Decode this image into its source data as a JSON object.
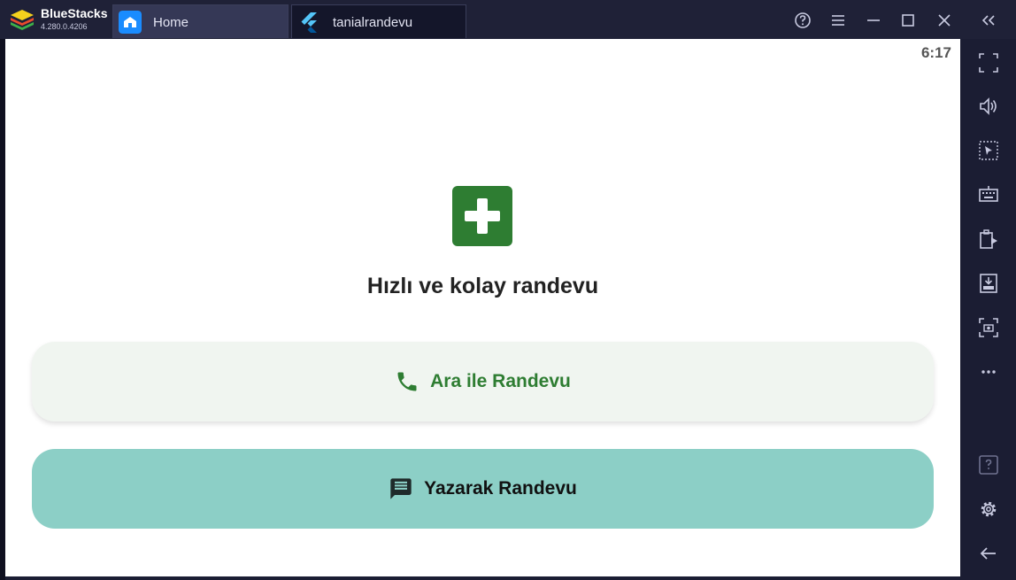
{
  "titlebar": {
    "brand_name": "BlueStacks",
    "brand_version": "4.280.0.4206",
    "tabs": [
      {
        "label": "Home",
        "icon": "home-icon"
      },
      {
        "label": "tanialrandevu",
        "icon": "flutter-icon"
      }
    ],
    "controls": [
      "help-icon",
      "menu-icon",
      "minimize-icon",
      "maximize-icon",
      "close-icon",
      "collapse-sidebar-icon"
    ]
  },
  "sidebar": {
    "top_items": [
      "fullscreen-icon",
      "volume-icon",
      "select-cursor-icon",
      "keyboard-icon",
      "copy-paste-icon",
      "apk-install-icon",
      "screenshot-icon",
      "more-icon"
    ],
    "bottom_items": [
      "help-icon",
      "settings-icon",
      "back-icon"
    ]
  },
  "android": {
    "clock": "6:17",
    "hero_icon": "medical-cross-icon",
    "headline": "Hızlı ve kolay randevu",
    "buttons": [
      {
        "label": "Ara ile Randevu",
        "icon": "phone-icon"
      },
      {
        "label": "Yazarak Randevu",
        "icon": "chat-icon"
      }
    ]
  },
  "colors": {
    "titlebar_bg": "#1f2137",
    "primary_green": "#2e7d32",
    "call_button_bg": "#f0f5f0",
    "write_button_bg": "#8ccfc6"
  }
}
